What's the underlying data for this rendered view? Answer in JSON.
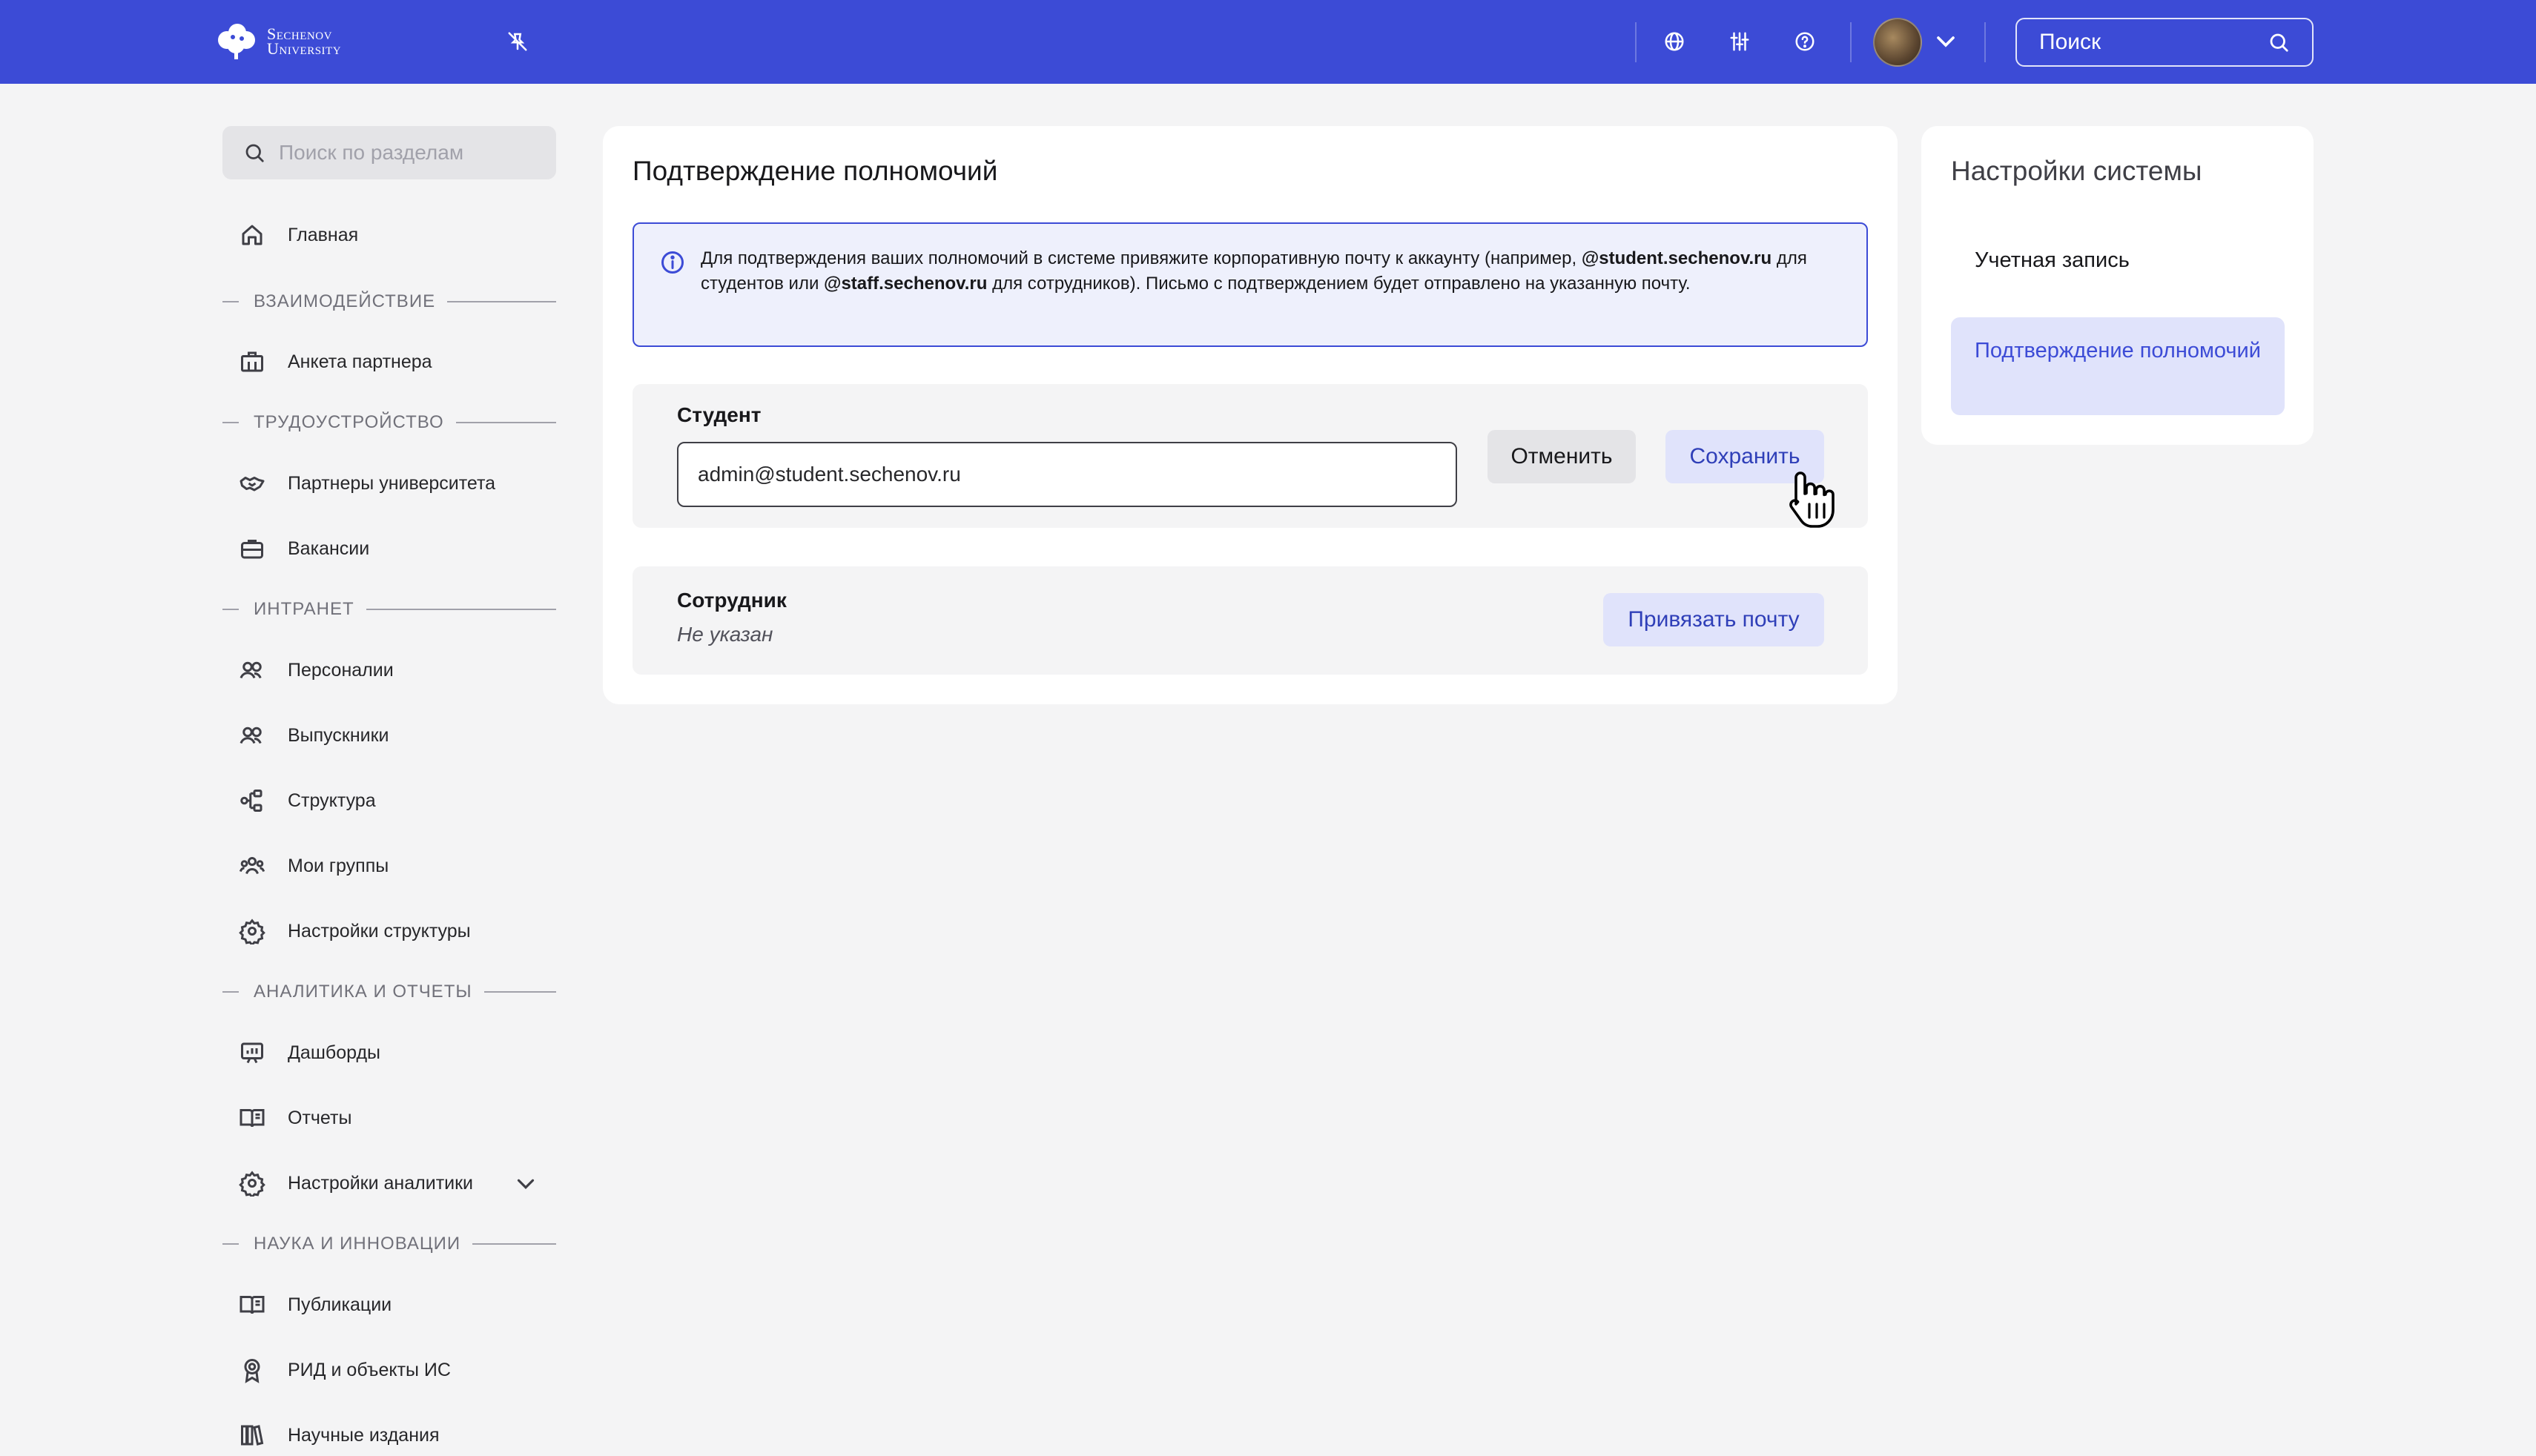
{
  "header": {
    "logo_line1": "Sechenov",
    "logo_line2": "University",
    "search_label": "Поиск",
    "icons": [
      "unpin-icon",
      "globe-icon",
      "sliders-icon",
      "help-icon",
      "user-avatar",
      "chevron-down-icon",
      "search-icon"
    ]
  },
  "sidebar": {
    "search_placeholder": "Поиск по разделам",
    "items": [
      {
        "label": "Главная",
        "icon": "home-icon"
      },
      {
        "section": "ВЗАИМОДЕЙСТВИЕ"
      },
      {
        "label": "Анкета партнера",
        "icon": "building-icon"
      },
      {
        "section": "ТРУДОУСТРОЙСТВО"
      },
      {
        "label": "Партнеры университета",
        "icon": "handshake-icon"
      },
      {
        "label": "Вакансии",
        "icon": "briefcase-icon"
      },
      {
        "section": "ИНТРАНЕТ"
      },
      {
        "label": "Персоналии",
        "icon": "users-icon"
      },
      {
        "label": "Выпускники",
        "icon": "users-icon"
      },
      {
        "label": "Структура",
        "icon": "structure-icon"
      },
      {
        "label": "Мои группы",
        "icon": "group-icon"
      },
      {
        "label": "Настройки структуры",
        "icon": "gear-icon"
      },
      {
        "section": "АНАЛИТИКА И ОТЧЕТЫ"
      },
      {
        "label": "Дашборды",
        "icon": "dashboard-icon"
      },
      {
        "label": "Отчеты",
        "icon": "report-icon"
      },
      {
        "label": "Настройки аналитики",
        "icon": "gear-icon"
      },
      {
        "section": "НАУКА И ИННОВАЦИИ"
      },
      {
        "label": "Публикации",
        "icon": "book-icon"
      },
      {
        "label": "РИД и объекты ИС",
        "icon": "award-icon"
      },
      {
        "label": "Научные издания",
        "icon": "library-icon"
      }
    ]
  },
  "main": {
    "title": "Подтверждение полномочий",
    "info": {
      "part1": "Для подтверждения ваших полномочий в системе привяжите корпоративную почту к аккаунту (например,",
      "domain_student": "@student.sechenov.ru",
      "part2": "для студентов или",
      "domain_staff": "@staff.sechenov.ru",
      "part3": "для сотрудников). Письмо с подтверждением будет отправлено на указанную почту."
    },
    "student": {
      "title": "Студент",
      "email_value": "admin@student.sechenov.ru",
      "cancel_label": "Отменить",
      "save_label": "Сохранить"
    },
    "employee": {
      "title": "Сотрудник",
      "status": "Не указан",
      "bind_label": "Привязать почту"
    }
  },
  "settings_panel": {
    "title": "Настройки системы",
    "items": [
      {
        "label": "Учетная запись",
        "active": false
      },
      {
        "label": "Подтверждение полномочий",
        "active": true
      }
    ]
  },
  "colors": {
    "header_bg": "#3c4bd6",
    "accent": "#3c4bd6",
    "active_bg": "#e0e3fb",
    "page_bg": "#f4f4f5"
  }
}
